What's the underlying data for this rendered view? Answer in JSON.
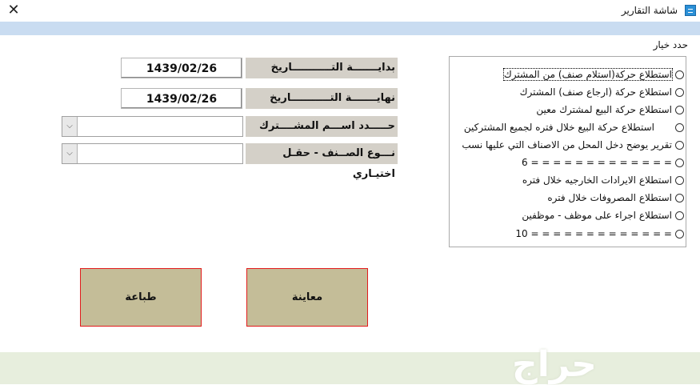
{
  "window": {
    "title": "شاشة التقارير",
    "icon": "report-icon",
    "close_glyph": "✕"
  },
  "form": {
    "start_date_label": "بدايـــــــة التـــــــــــاريخ",
    "start_date_value": "1439/02/26",
    "end_date_label": "نهايـــــــة التـــــــــــاريخ",
    "end_date_value": "1439/02/26",
    "subscriber_label": "حـــــدد اســـم المشــــترك",
    "subscriber_value": "",
    "item_type_label": "نـــوع الصــنف - حقـل اختيـاري",
    "item_type_value": "",
    "combo_arrow": "⌵"
  },
  "options": {
    "group_label": "حدد خيار",
    "items": [
      "استطلاع حركة(استلام صنف) من المشترك",
      "استطلاع حركة (ارجاع صنف) المشترك",
      "استطلاع حركة البيع لمشترك معين",
      "استطلاع حركة البيع خلال فتره لجميع المشتركين",
      "تقرير يوضح دخل المحل من الاصناف التي عليها نسب",
      "= = = = = = = = = = = = = 6",
      "استطلاع الايرادات الخارجيه خلال فتره",
      "استطلاع المصروفات خلال فتره",
      "استطلاع اجراء على موظف - موظفين",
      "= = = = = = = = = = = = = 10"
    ]
  },
  "buttons": {
    "preview_label": "معاينة",
    "print_label": "طباعة"
  },
  "watermark": "حراج",
  "colors": {
    "button_bg": "#c4bd98",
    "button_border": "#e21b1b",
    "header_band": "#c9dcf1",
    "footer_band": "#e7eedd"
  }
}
